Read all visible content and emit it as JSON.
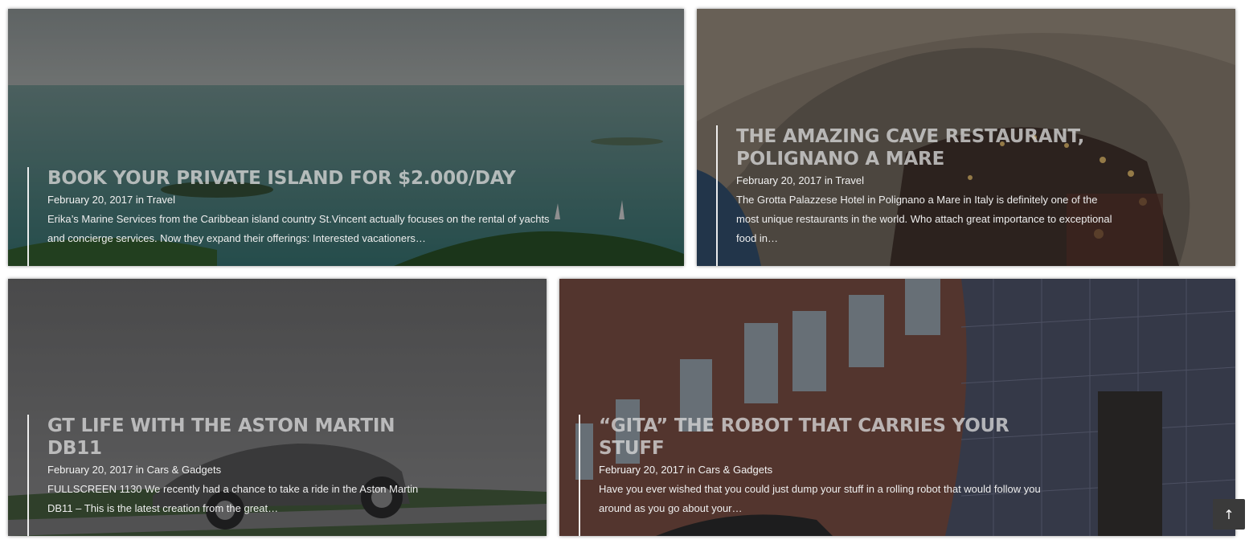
{
  "posts": [
    {
      "title": "Book your private island for $2.000/day",
      "date": "February 20, 2017",
      "in": "in",
      "category": "Travel",
      "excerpt": "Erika’s Marine Services from the Caribbean island country St.Vincent actually focuses on the rental of yachts and concierge services. Now they expand their offerings: Interested vacationers…"
    },
    {
      "title": "The Amazing Cave Restaurant, Polignano a Mare",
      "date": "February 20, 2017",
      "in": "in",
      "category": "Travel",
      "excerpt": "The Grotta Palazzese Hotel in Polignano a Mare in Italy is definitely one of the most unique restaurants in the world. Who attach great importance to exceptional food in…"
    },
    {
      "title": "GT Life with the Aston Martin DB11",
      "date": "February 20, 2017",
      "in": "in",
      "category": "Cars & Gadgets",
      "excerpt": "FULLSCREEN 1130 We recently had a chance to take a ride in the Aston Martin DB11 – This is the latest creation from the great…"
    },
    {
      "title": "“Gita” the Robot that Carries your Stuff",
      "date": "February 20, 2017",
      "in": "in",
      "category": "Cars & Gadgets",
      "excerpt": "Have you ever wished that you could just dump your stuff in a rolling robot that would follow you around as you go about your…"
    }
  ],
  "scroll_top": {
    "icon": "arrow-up-icon",
    "glyph": "↑"
  },
  "colors": {
    "overlay": "#141418",
    "title": "#d7d7d7",
    "text": "#f2f2f2",
    "scroll_button": "#3a3a3a"
  }
}
